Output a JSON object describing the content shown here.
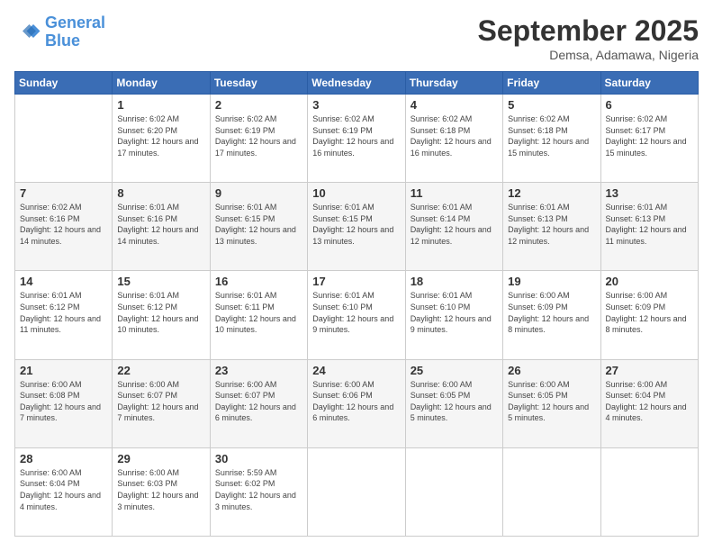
{
  "logo": {
    "line1": "General",
    "line2": "Blue"
  },
  "header": {
    "month": "September 2025",
    "location": "Demsa, Adamawa, Nigeria"
  },
  "weekdays": [
    "Sunday",
    "Monday",
    "Tuesday",
    "Wednesday",
    "Thursday",
    "Friday",
    "Saturday"
  ],
  "weeks": [
    [
      {
        "day": "",
        "sunrise": "",
        "sunset": "",
        "daylight": ""
      },
      {
        "day": "1",
        "sunrise": "Sunrise: 6:02 AM",
        "sunset": "Sunset: 6:20 PM",
        "daylight": "Daylight: 12 hours and 17 minutes."
      },
      {
        "day": "2",
        "sunrise": "Sunrise: 6:02 AM",
        "sunset": "Sunset: 6:19 PM",
        "daylight": "Daylight: 12 hours and 17 minutes."
      },
      {
        "day": "3",
        "sunrise": "Sunrise: 6:02 AM",
        "sunset": "Sunset: 6:19 PM",
        "daylight": "Daylight: 12 hours and 16 minutes."
      },
      {
        "day": "4",
        "sunrise": "Sunrise: 6:02 AM",
        "sunset": "Sunset: 6:18 PM",
        "daylight": "Daylight: 12 hours and 16 minutes."
      },
      {
        "day": "5",
        "sunrise": "Sunrise: 6:02 AM",
        "sunset": "Sunset: 6:18 PM",
        "daylight": "Daylight: 12 hours and 15 minutes."
      },
      {
        "day": "6",
        "sunrise": "Sunrise: 6:02 AM",
        "sunset": "Sunset: 6:17 PM",
        "daylight": "Daylight: 12 hours and 15 minutes."
      }
    ],
    [
      {
        "day": "7",
        "sunrise": "Sunrise: 6:02 AM",
        "sunset": "Sunset: 6:16 PM",
        "daylight": "Daylight: 12 hours and 14 minutes."
      },
      {
        "day": "8",
        "sunrise": "Sunrise: 6:01 AM",
        "sunset": "Sunset: 6:16 PM",
        "daylight": "Daylight: 12 hours and 14 minutes."
      },
      {
        "day": "9",
        "sunrise": "Sunrise: 6:01 AM",
        "sunset": "Sunset: 6:15 PM",
        "daylight": "Daylight: 12 hours and 13 minutes."
      },
      {
        "day": "10",
        "sunrise": "Sunrise: 6:01 AM",
        "sunset": "Sunset: 6:15 PM",
        "daylight": "Daylight: 12 hours and 13 minutes."
      },
      {
        "day": "11",
        "sunrise": "Sunrise: 6:01 AM",
        "sunset": "Sunset: 6:14 PM",
        "daylight": "Daylight: 12 hours and 12 minutes."
      },
      {
        "day": "12",
        "sunrise": "Sunrise: 6:01 AM",
        "sunset": "Sunset: 6:13 PM",
        "daylight": "Daylight: 12 hours and 12 minutes."
      },
      {
        "day": "13",
        "sunrise": "Sunrise: 6:01 AM",
        "sunset": "Sunset: 6:13 PM",
        "daylight": "Daylight: 12 hours and 11 minutes."
      }
    ],
    [
      {
        "day": "14",
        "sunrise": "Sunrise: 6:01 AM",
        "sunset": "Sunset: 6:12 PM",
        "daylight": "Daylight: 12 hours and 11 minutes."
      },
      {
        "day": "15",
        "sunrise": "Sunrise: 6:01 AM",
        "sunset": "Sunset: 6:12 PM",
        "daylight": "Daylight: 12 hours and 10 minutes."
      },
      {
        "day": "16",
        "sunrise": "Sunrise: 6:01 AM",
        "sunset": "Sunset: 6:11 PM",
        "daylight": "Daylight: 12 hours and 10 minutes."
      },
      {
        "day": "17",
        "sunrise": "Sunrise: 6:01 AM",
        "sunset": "Sunset: 6:10 PM",
        "daylight": "Daylight: 12 hours and 9 minutes."
      },
      {
        "day": "18",
        "sunrise": "Sunrise: 6:01 AM",
        "sunset": "Sunset: 6:10 PM",
        "daylight": "Daylight: 12 hours and 9 minutes."
      },
      {
        "day": "19",
        "sunrise": "Sunrise: 6:00 AM",
        "sunset": "Sunset: 6:09 PM",
        "daylight": "Daylight: 12 hours and 8 minutes."
      },
      {
        "day": "20",
        "sunrise": "Sunrise: 6:00 AM",
        "sunset": "Sunset: 6:09 PM",
        "daylight": "Daylight: 12 hours and 8 minutes."
      }
    ],
    [
      {
        "day": "21",
        "sunrise": "Sunrise: 6:00 AM",
        "sunset": "Sunset: 6:08 PM",
        "daylight": "Daylight: 12 hours and 7 minutes."
      },
      {
        "day": "22",
        "sunrise": "Sunrise: 6:00 AM",
        "sunset": "Sunset: 6:07 PM",
        "daylight": "Daylight: 12 hours and 7 minutes."
      },
      {
        "day": "23",
        "sunrise": "Sunrise: 6:00 AM",
        "sunset": "Sunset: 6:07 PM",
        "daylight": "Daylight: 12 hours and 6 minutes."
      },
      {
        "day": "24",
        "sunrise": "Sunrise: 6:00 AM",
        "sunset": "Sunset: 6:06 PM",
        "daylight": "Daylight: 12 hours and 6 minutes."
      },
      {
        "day": "25",
        "sunrise": "Sunrise: 6:00 AM",
        "sunset": "Sunset: 6:05 PM",
        "daylight": "Daylight: 12 hours and 5 minutes."
      },
      {
        "day": "26",
        "sunrise": "Sunrise: 6:00 AM",
        "sunset": "Sunset: 6:05 PM",
        "daylight": "Daylight: 12 hours and 5 minutes."
      },
      {
        "day": "27",
        "sunrise": "Sunrise: 6:00 AM",
        "sunset": "Sunset: 6:04 PM",
        "daylight": "Daylight: 12 hours and 4 minutes."
      }
    ],
    [
      {
        "day": "28",
        "sunrise": "Sunrise: 6:00 AM",
        "sunset": "Sunset: 6:04 PM",
        "daylight": "Daylight: 12 hours and 4 minutes."
      },
      {
        "day": "29",
        "sunrise": "Sunrise: 6:00 AM",
        "sunset": "Sunset: 6:03 PM",
        "daylight": "Daylight: 12 hours and 3 minutes."
      },
      {
        "day": "30",
        "sunrise": "Sunrise: 5:59 AM",
        "sunset": "Sunset: 6:02 PM",
        "daylight": "Daylight: 12 hours and 3 minutes."
      },
      {
        "day": "",
        "sunrise": "",
        "sunset": "",
        "daylight": ""
      },
      {
        "day": "",
        "sunrise": "",
        "sunset": "",
        "daylight": ""
      },
      {
        "day": "",
        "sunrise": "",
        "sunset": "",
        "daylight": ""
      },
      {
        "day": "",
        "sunrise": "",
        "sunset": "",
        "daylight": ""
      }
    ]
  ]
}
